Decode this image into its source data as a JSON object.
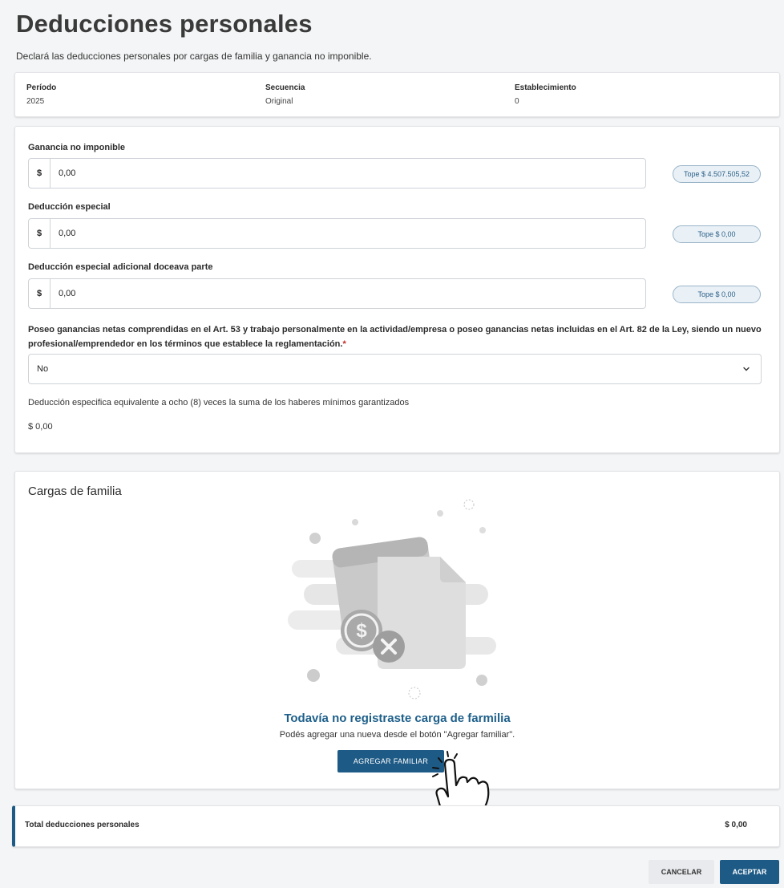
{
  "page": {
    "title": "Deducciones personales",
    "subtitle": "Declará las deducciones personales por cargas de familia y ganancia no imponible."
  },
  "info": {
    "periodo_label": "Período",
    "periodo_value": "2025",
    "secuencia_label": "Secuencia",
    "secuencia_value": "Original",
    "establecimiento_label": "Establecimiento",
    "establecimiento_value": "0"
  },
  "form": {
    "currency_symbol": "$",
    "ganancia_label": "Ganancia no imponible",
    "ganancia_value": "0,00",
    "ganancia_tope": "Tope $ 4.507.505,52",
    "especial_label": "Deducción especial",
    "especial_value": "0,00",
    "especial_tope": "Tope $ 0,00",
    "adicional_label": "Deducción especial adicional doceava parte",
    "adicional_value": "0,00",
    "adicional_tope": "Tope $ 0,00",
    "question": "Poseo ganancias netas comprendidas en el Art. 53 y trabajo personalmente en la actividad/empresa o poseo ganancias netas incluidas en el Art. 82 de la Ley, siendo un nuevo profesional/emprendedor en los términos que establece la reglamentación.",
    "question_required_mark": "*",
    "select_value": "No",
    "deduccion_especifica_label": "Deducción especifica equivalente a ocho (8) veces la suma de los haberes mínimos garantizados",
    "deduccion_especifica_value": "$ 0,00"
  },
  "family": {
    "title": "Cargas de familia",
    "empty_title": "Todavía no registraste carga de farmilia",
    "empty_subtitle": "Podés agregar una nueva desde el botón \"Agregar familiar\".",
    "add_button": "AGREGAR FAMILIAR"
  },
  "total": {
    "label": "Total deducciones personales",
    "value": "$ 0,00"
  },
  "actions": {
    "cancel": "CANCELAR",
    "accept": "ACEPTAR"
  },
  "colors": {
    "primary": "#1d5a85",
    "required": "#c62828",
    "tope_bg": "#e9f1f7"
  },
  "icons": [
    "chevron-down-icon",
    "empty-wallet-illustration",
    "pointing-hand-icon"
  ]
}
